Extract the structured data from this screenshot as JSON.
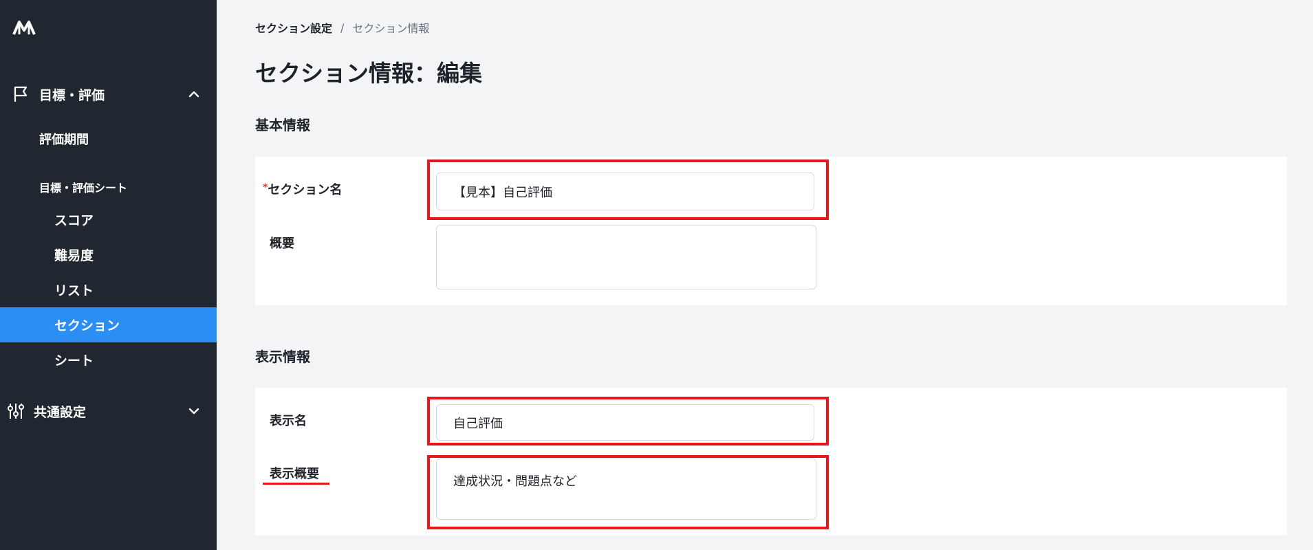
{
  "sidebar": {
    "logo_icon": "brand-logo-icon",
    "groups": [
      {
        "label": "目標・評価",
        "icon": "flag-icon",
        "expanded": true
      },
      {
        "label": "共通設定",
        "icon": "sliders-icon",
        "expanded": false
      }
    ],
    "sub_items": {
      "evaluation_period": "評価期間",
      "sheet_category": "目標・評価シート"
    },
    "items": [
      {
        "label": "スコア"
      },
      {
        "label": "難易度"
      },
      {
        "label": "リスト"
      },
      {
        "label": "セクション",
        "active": true
      },
      {
        "label": "シート"
      }
    ],
    "active_color": "#2b8ef5",
    "background_color": "#212730"
  },
  "breadcrumb": {
    "root": "セクション設定",
    "separator": "/",
    "current": "セクション情報"
  },
  "page_title": "セクション情報：編集",
  "basic_info": {
    "title": "基本情報",
    "section_name": {
      "label": "セクション名",
      "required_mark": "*",
      "value": "【見本】自己評価"
    },
    "overview": {
      "label": "概要",
      "value": ""
    }
  },
  "display_info": {
    "title": "表示情報",
    "display_name": {
      "label": "表示名",
      "value": "自己評価"
    },
    "display_overview": {
      "label": "表示概要",
      "value": "達成状況・問題点など"
    }
  },
  "annotation_color": "#e8151b"
}
